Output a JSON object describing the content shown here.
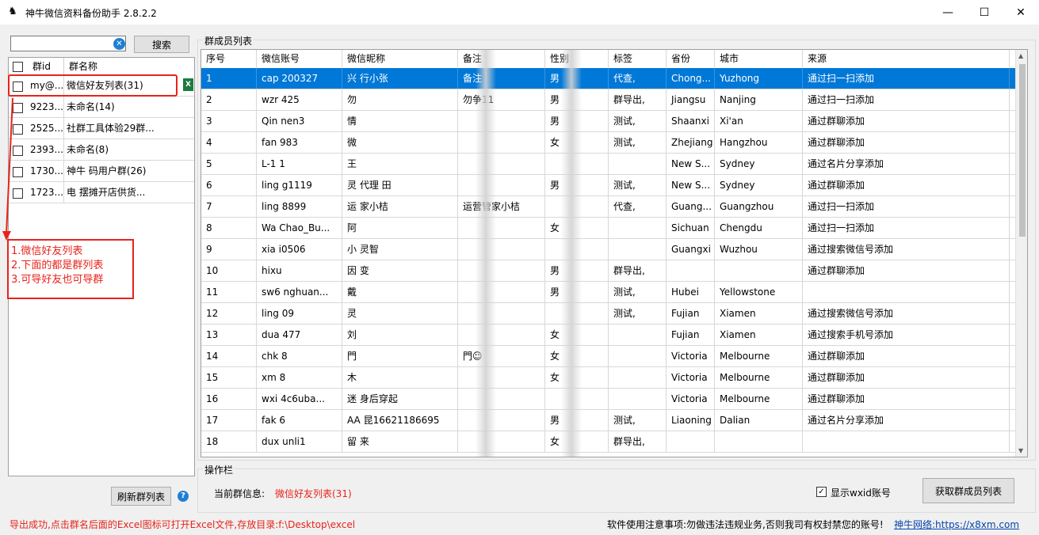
{
  "window": {
    "title": "神牛微信资料备份助手 2.8.2.2",
    "minimize": "—",
    "maximize": "☐",
    "close": "✕"
  },
  "left": {
    "search_value": "",
    "search_button": "搜索",
    "headers": [
      "群id",
      "群名称"
    ],
    "groups": [
      {
        "id": "my@...",
        "name": "微信好友列表(31)",
        "selected": true
      },
      {
        "id": "9223...",
        "name": "未命名(14)"
      },
      {
        "id": "2525...",
        "name": "社群工具体验29群..."
      },
      {
        "id": "2393...",
        "name": "未命名(8)"
      },
      {
        "id": "1730...",
        "name": "神牛  码用户群(26)"
      },
      {
        "id": "1723...",
        "name": "电  摆摊开店供货..."
      }
    ],
    "annotation": [
      "1.微信好友列表",
      "2.下面的都是群列表",
      "3.可导好友也可导群"
    ],
    "refresh_button": "刷新群列表"
  },
  "members": {
    "section_label": "群成员列表",
    "headers": [
      "序号",
      "微信账号",
      "微信昵称",
      "备注",
      "性别",
      "标签",
      "省份",
      "城市",
      "来源"
    ],
    "rows": [
      [
        "1",
        "cap    200327",
        "兴  行小张",
        "备注",
        "男",
        "代查,",
        "Chong...",
        "Yuzhong",
        "通过扫一扫添加"
      ],
      [
        "2",
        "wzr    425",
        "勿",
        "勿争11",
        "男",
        "群导出,",
        "Jiangsu",
        "Nanjing",
        "通过扫一扫添加"
      ],
      [
        "3",
        "Qin    nen3",
        "情",
        "",
        "男",
        "测试,",
        "Shaanxi",
        "Xi'an",
        "通过群聊添加"
      ],
      [
        "4",
        "fan    983",
        "微",
        "",
        "女",
        "测试,",
        "Zhejiang",
        "Hangzhou",
        "通过群聊添加"
      ],
      [
        "5",
        "L-1    1",
        "王",
        "",
        "",
        "",
        "New S...",
        "Sydney",
        "通过名片分享添加"
      ],
      [
        "6",
        "ling    g1119",
        "灵  代理 田",
        "",
        "男",
        "测试,",
        "New S...",
        "Sydney",
        "通过群聊添加"
      ],
      [
        "7",
        "ling    8899",
        "运  家小桔",
        "运营管家小桔",
        "",
        "代查,",
        "Guang...",
        "Guangzhou",
        "通过扫一扫添加"
      ],
      [
        "8",
        "Wa    Chao_Bu...",
        "阿",
        "",
        "女",
        "",
        "Sichuan",
        "Chengdu",
        "通过扫一扫添加"
      ],
      [
        "9",
        "xia    i0506",
        "小  灵智",
        "",
        "",
        "",
        "Guangxi",
        "Wuzhou",
        "通过搜索微信号添加"
      ],
      [
        "10",
        "hixu",
        "因  变",
        "",
        "男",
        "群导出,",
        "",
        "",
        "通过群聊添加"
      ],
      [
        "11",
        "sw6    nghuan...",
        "戴",
        "",
        "男",
        "测试,",
        "Hubei",
        "Yellowstone",
        ""
      ],
      [
        "12",
        "ling    09",
        "灵",
        "",
        "",
        "测试,",
        "Fujian",
        "Xiamen",
        "通过搜索微信号添加"
      ],
      [
        "13",
        "dua    477",
        "刘",
        "",
        "女",
        "",
        "Fujian",
        "Xiamen",
        "通过搜索手机号添加"
      ],
      [
        "14",
        "chk    8",
        "門",
        "門☺",
        "女",
        "",
        "Victoria",
        "Melbourne",
        "通过群聊添加"
      ],
      [
        "15",
        "xm    8",
        "木",
        "",
        "女",
        "",
        "Victoria",
        "Melbourne",
        "通过群聊添加"
      ],
      [
        "16",
        "wxi    4c6uba...",
        "迷  身后穿起",
        "",
        "",
        "",
        "Victoria",
        "Melbourne",
        "通过群聊添加"
      ],
      [
        "17",
        "fak    6",
        "AA  昆16621186695",
        "",
        "男",
        "测试,",
        "Liaoning",
        "Dalian",
        "通过名片分享添加"
      ],
      [
        "18",
        "dux    unli1",
        "留  来",
        "",
        "女",
        "群导出,",
        "",
        "",
        ""
      ]
    ]
  },
  "ops": {
    "section_label": "操作栏",
    "current_label": "当前群信息:",
    "current_value": "微信好友列表(31)",
    "show_wxid_label": "显示wxid账号",
    "show_wxid_checked": true,
    "fetch_button": "获取群成员列表"
  },
  "status": {
    "left": "导出成功,点击群名后面的Excel图标可打开Excel文件,存放目录:f:\\Desktop\\excel",
    "notice": "软件使用注意事项:勿做违法违规业务,否则我司有权封禁您的账号!",
    "link": "神牛网络:https://x8xm.com"
  },
  "icons": {
    "app": "ox-logo-icon",
    "clear": "clear-icon",
    "excel": "excel-icon",
    "help": "help-icon"
  },
  "colors": {
    "selected": "#0078d7",
    "annotation": "#e8231b",
    "link": "#0645ad"
  }
}
